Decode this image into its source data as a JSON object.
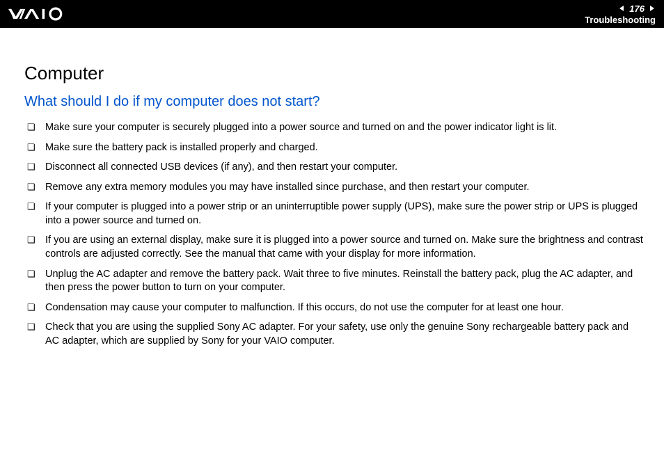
{
  "header": {
    "page_number": "176",
    "section": "Troubleshooting"
  },
  "content": {
    "title": "Computer",
    "question": "What should I do if my computer does not start?",
    "bullets": [
      "Make sure your computer is securely plugged into a power source and turned on and the power indicator light is lit.",
      "Make sure the battery pack is installed properly and charged.",
      "Disconnect all connected USB devices (if any), and then restart your computer.",
      "Remove any extra memory modules you may have installed since purchase, and then restart your computer.",
      "If your computer is plugged into a power strip or an uninterruptible power supply (UPS), make sure the power strip or UPS is plugged into a power source and turned on.",
      "If you are using an external display, make sure it is plugged into a power source and turned on. Make sure the brightness and contrast controls are adjusted correctly. See the manual that came with your display for more information.",
      "Unplug the AC adapter and remove the battery pack. Wait three to five minutes. Reinstall the battery pack, plug the AC adapter, and then press the power button to turn on your computer.",
      "Condensation may cause your computer to malfunction. If this occurs, do not use the computer for at least one hour.",
      "Check that you are using the supplied Sony AC adapter. For your safety, use only the genuine Sony rechargeable battery pack and AC adapter, which are supplied by Sony for your VAIO computer."
    ]
  }
}
